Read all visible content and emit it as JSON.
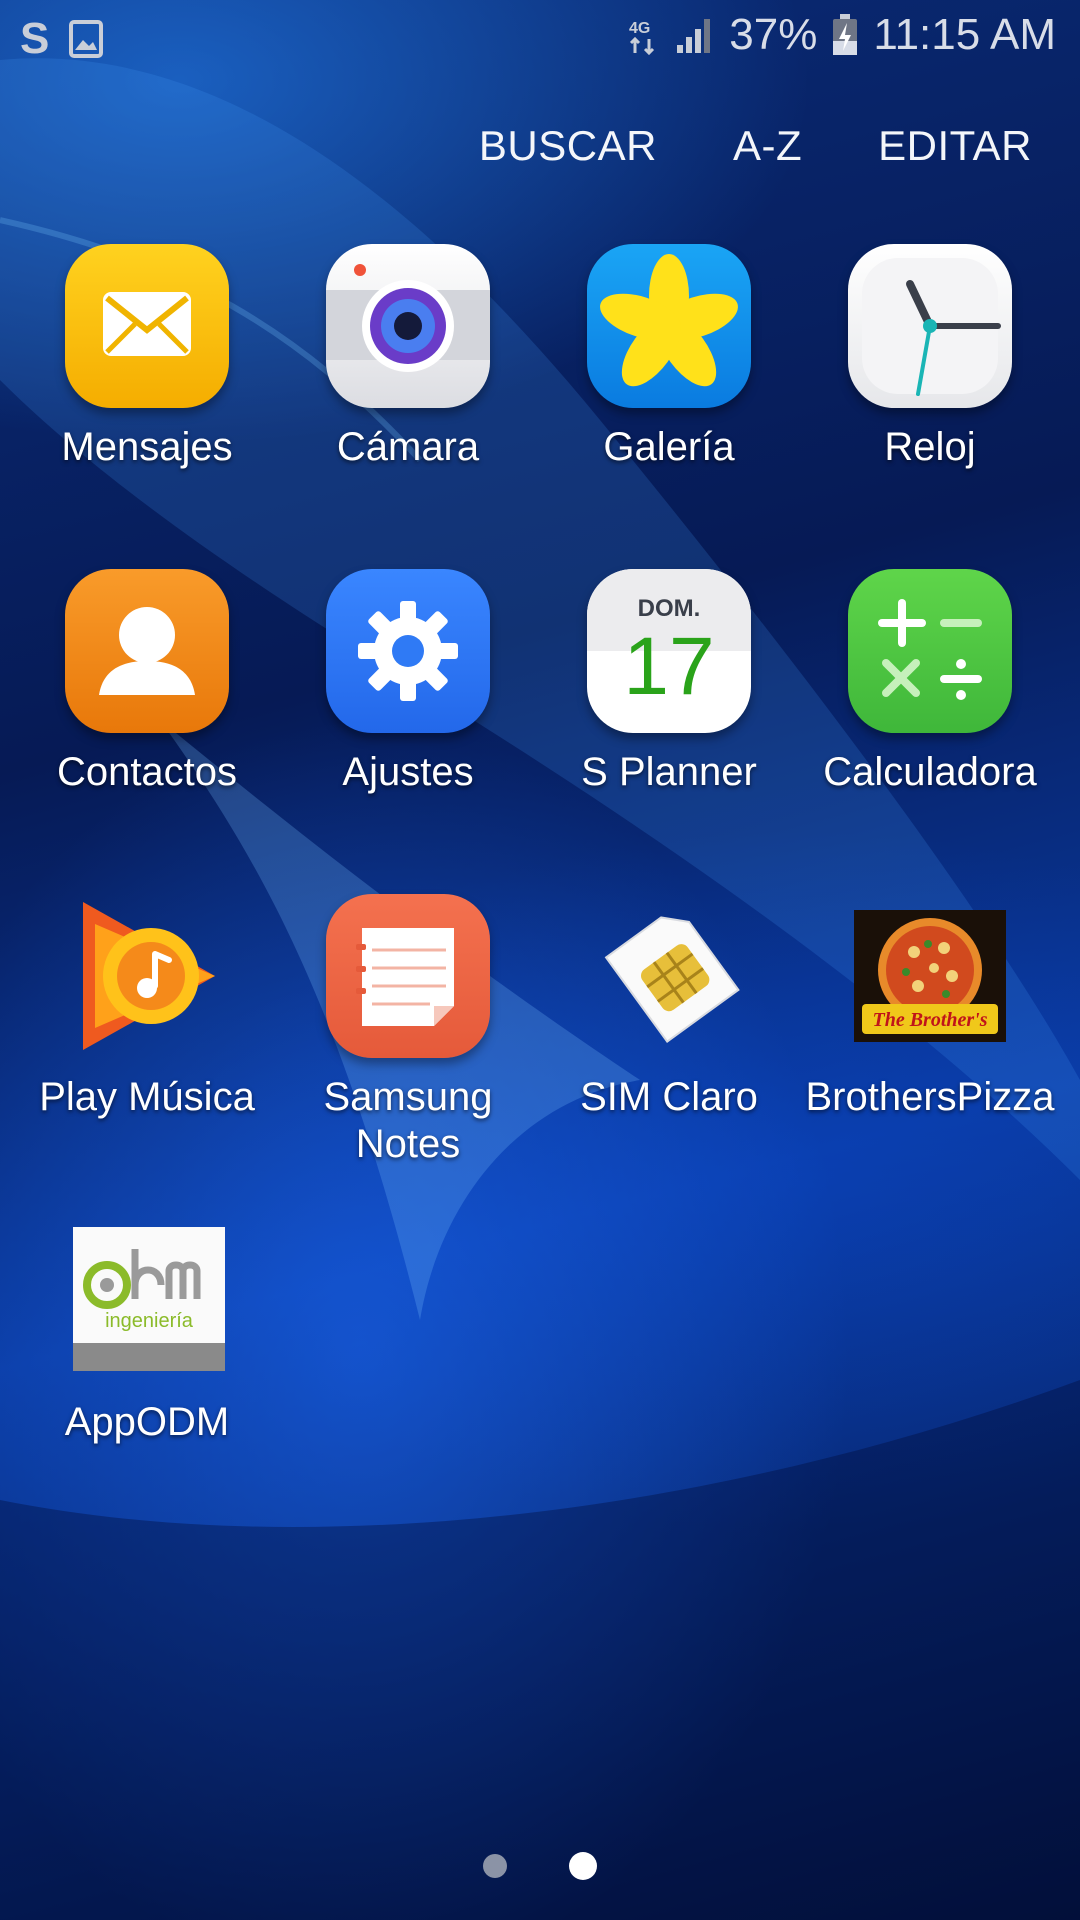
{
  "status_bar": {
    "left_icons": [
      "s-app-icon",
      "image-icon"
    ],
    "network": "4G",
    "battery": "37%",
    "time": "11:15 AM"
  },
  "top_actions": {
    "search": "BUSCAR",
    "sort": "A-Z",
    "edit": "EDITAR"
  },
  "apps": [
    {
      "label": "Mensajes",
      "icon": "messages-icon"
    },
    {
      "label": "Cámara",
      "icon": "camera-icon"
    },
    {
      "label": "Galería",
      "icon": "gallery-icon"
    },
    {
      "label": "Reloj",
      "icon": "clock-icon"
    },
    {
      "label": "Contactos",
      "icon": "contacts-icon"
    },
    {
      "label": "Ajustes",
      "icon": "settings-icon"
    },
    {
      "label": "S Planner",
      "icon": "calendar-icon",
      "day": "DOM.",
      "date": "17"
    },
    {
      "label": "Calculadora",
      "icon": "calculator-icon"
    },
    {
      "label": "Play Música",
      "icon": "play-music-icon"
    },
    {
      "label": "Samsung\nNotes",
      "icon": "notes-icon"
    },
    {
      "label": "SIM Claro",
      "icon": "sim-card-icon"
    },
    {
      "label": "BrothersPizza",
      "icon": "pizza-logo-icon",
      "logo_text": "The Brother's"
    },
    {
      "label": "AppODM",
      "icon": "odm-logo-icon",
      "logo_text": "ingeniería"
    }
  ],
  "pagination": {
    "pages": 2,
    "current": 2
  }
}
